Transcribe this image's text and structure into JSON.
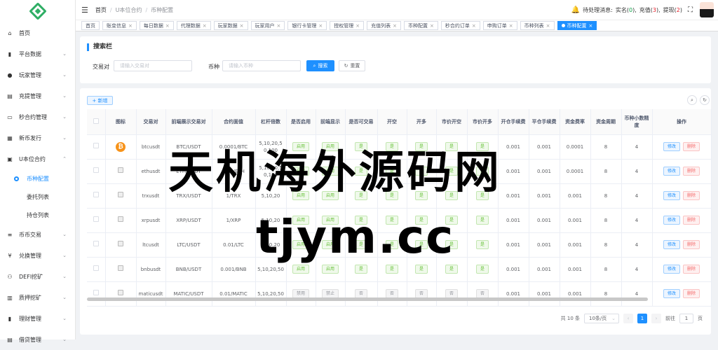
{
  "sidebar": {
    "items": [
      {
        "icon": "home-icon",
        "glyph": "⌂",
        "label": "首页"
      },
      {
        "icon": "chart-icon",
        "glyph": "▮",
        "label": "平台数据",
        "arrow": "⌄"
      },
      {
        "icon": "user-icon",
        "glyph": "●",
        "label": "玩家管理",
        "arrow": "⌄"
      },
      {
        "icon": "file-icon",
        "glyph": "▤",
        "label": "充提管理",
        "arrow": "⌄"
      },
      {
        "icon": "monitor-icon",
        "glyph": "▭",
        "label": "秒合约管理",
        "arrow": "⌄"
      },
      {
        "icon": "coin-issue-icon",
        "glyph": "▦",
        "label": "新币发行",
        "arrow": "⌄"
      },
      {
        "icon": "contract-icon",
        "glyph": "▣",
        "label": "U本位合约",
        "arrow": "⌃"
      }
    ],
    "sub_items": [
      {
        "label": "币种配置",
        "active": true
      },
      {
        "label": "委托列表",
        "active": false
      },
      {
        "label": "持仓列表",
        "active": false
      }
    ],
    "items_after": [
      {
        "icon": "list-icon",
        "glyph": "≡",
        "label": "币币交易",
        "arrow": "⌄"
      },
      {
        "icon": "yen-icon",
        "glyph": "¥",
        "label": "兑换管理",
        "arrow": "⌄"
      },
      {
        "icon": "defi-icon",
        "glyph": "⚇",
        "label": "DEFI挖矿",
        "arrow": "⌄"
      },
      {
        "icon": "pledge-icon",
        "glyph": "▥",
        "label": "质押挖矿",
        "arrow": "⌄"
      },
      {
        "icon": "finance-icon",
        "glyph": "▮",
        "label": "理财管理",
        "arrow": "⌄"
      },
      {
        "icon": "loan-icon",
        "glyph": "▤",
        "label": "借贷管理",
        "arrow": "⌄"
      }
    ]
  },
  "header": {
    "breadcrumb": [
      "首页",
      "U本位合约",
      "币种配置"
    ],
    "pending_label": "待处理消息:",
    "pending_items": [
      {
        "label": "实名",
        "count": "0",
        "color": "green"
      },
      {
        "label": "充值",
        "count": "3",
        "color": "red"
      },
      {
        "label": "提现",
        "count": "2",
        "color": "red"
      }
    ]
  },
  "tags": [
    {
      "label": "首页",
      "closable": false,
      "active": false
    },
    {
      "label": "账变信息",
      "closable": true,
      "active": false
    },
    {
      "label": "每日数据",
      "closable": true,
      "active": false
    },
    {
      "label": "代理数据",
      "closable": true,
      "active": false
    },
    {
      "label": "玩家数据",
      "closable": true,
      "active": false
    },
    {
      "label": "玩家用户",
      "closable": true,
      "active": false
    },
    {
      "label": "银行卡管理",
      "closable": true,
      "active": false
    },
    {
      "label": "授权管理",
      "closable": true,
      "active": false
    },
    {
      "label": "充值列表",
      "closable": true,
      "active": false
    },
    {
      "label": "币种配置",
      "closable": true,
      "active": false
    },
    {
      "label": "秒合约订单",
      "closable": true,
      "active": false
    },
    {
      "label": "申购订单",
      "closable": true,
      "active": false
    },
    {
      "label": "币种列表",
      "closable": true,
      "active": false
    },
    {
      "label": "币种配置",
      "closable": true,
      "active": true
    }
  ],
  "search": {
    "title": "搜索栏",
    "pair_label": "交易对",
    "pair_placeholder": "请输入交易对",
    "coin_label": "币种",
    "coin_placeholder": "请输入币种",
    "search_btn": "搜索",
    "reset_btn": "重置"
  },
  "table": {
    "add_btn": "+ 新增",
    "headers": [
      "图标",
      "交易对",
      "前端展示交易对",
      "合约面值",
      "杠杆倍数",
      "是否启用",
      "前端显示",
      "是否可交易",
      "开空",
      "开多",
      "市价开空",
      "市价开多",
      "开仓手续费",
      "平仓手续费",
      "资金费率",
      "资金周期",
      "币种小数精度",
      "操作"
    ],
    "edit_label": "修改",
    "delete_label": "删除",
    "rows": [
      {
        "icon": "btc",
        "pair": "btcusdt",
        "display": "BTC/USDT",
        "face": "0.0001/BTC",
        "leverage": "5,10,20,50,100",
        "enabled": "启用",
        "show": "启用",
        "tradable": "是",
        "short": "是",
        "long": "是",
        "mshort": "是",
        "mlong": "是",
        "openfee": "0.001",
        "closefee": "0.001",
        "rate": "0.0001",
        "period": "8",
        "precision": "4",
        "on": true
      },
      {
        "icon": "img",
        "pair": "ethusdt",
        "display": "ETH/USDT",
        "face": "0.01/ETH",
        "leverage": "5,10,20,50,100",
        "enabled": "启用",
        "show": "启用",
        "tradable": "是",
        "short": "是",
        "long": "是",
        "mshort": "是",
        "mlong": "是",
        "openfee": "0.001",
        "closefee": "0.001",
        "rate": "0.0001",
        "period": "8",
        "precision": "4",
        "on": true
      },
      {
        "icon": "img",
        "pair": "trxusdt",
        "display": "TRX/USDT",
        "face": "1/TRX",
        "leverage": "5,10,20",
        "enabled": "启用",
        "show": "启用",
        "tradable": "是",
        "short": "是",
        "long": "是",
        "mshort": "是",
        "mlong": "是",
        "openfee": "0.001",
        "closefee": "0.001",
        "rate": "0.001",
        "period": "8",
        "precision": "4",
        "on": true
      },
      {
        "icon": "img",
        "pair": "xrpusdt",
        "display": "XRP/USDT",
        "face": "1/XRP",
        "leverage": "5,10,20",
        "enabled": "启用",
        "show": "启用",
        "tradable": "是",
        "short": "是",
        "long": "是",
        "mshort": "是",
        "mlong": "是",
        "openfee": "0.001",
        "closefee": "0.001",
        "rate": "0.001",
        "period": "8",
        "precision": "4",
        "on": true
      },
      {
        "icon": "img",
        "pair": "ltcusdt",
        "display": "LTC/USDT",
        "face": "0.01/LTC",
        "leverage": "5,10,20",
        "enabled": "启用",
        "show": "启用",
        "tradable": "是",
        "short": "是",
        "long": "是",
        "mshort": "是",
        "mlong": "是",
        "openfee": "0.001",
        "closefee": "0.001",
        "rate": "0.001",
        "period": "8",
        "precision": "4",
        "on": true
      },
      {
        "icon": "img",
        "pair": "bnbusdt",
        "display": "BNB/USDT",
        "face": "0.001/BNB",
        "leverage": "5,10,20,50",
        "enabled": "启用",
        "show": "启用",
        "tradable": "是",
        "short": "是",
        "long": "是",
        "mshort": "是",
        "mlong": "是",
        "openfee": "0.001",
        "closefee": "0.001",
        "rate": "0.001",
        "period": "8",
        "precision": "4",
        "on": true
      },
      {
        "icon": "img",
        "pair": "maticusdt",
        "display": "MATIC/USDT",
        "face": "0.01/MATIC",
        "leverage": "5,10,20,50",
        "enabled": "禁用",
        "show": "禁止",
        "tradable": "否",
        "short": "否",
        "long": "否",
        "mshort": "否",
        "mlong": "否",
        "openfee": "0.001",
        "closefee": "0.001",
        "rate": "0.001",
        "period": "8",
        "precision": "4",
        "on": false
      }
    ]
  },
  "pager": {
    "total": "共 10 条",
    "size": "10条/页",
    "current": "1",
    "goto": "前往",
    "page_suffix": "页",
    "jump_value": "1"
  },
  "watermark": {
    "line1": "天机海外源码网",
    "line2": "tjym.cc"
  }
}
